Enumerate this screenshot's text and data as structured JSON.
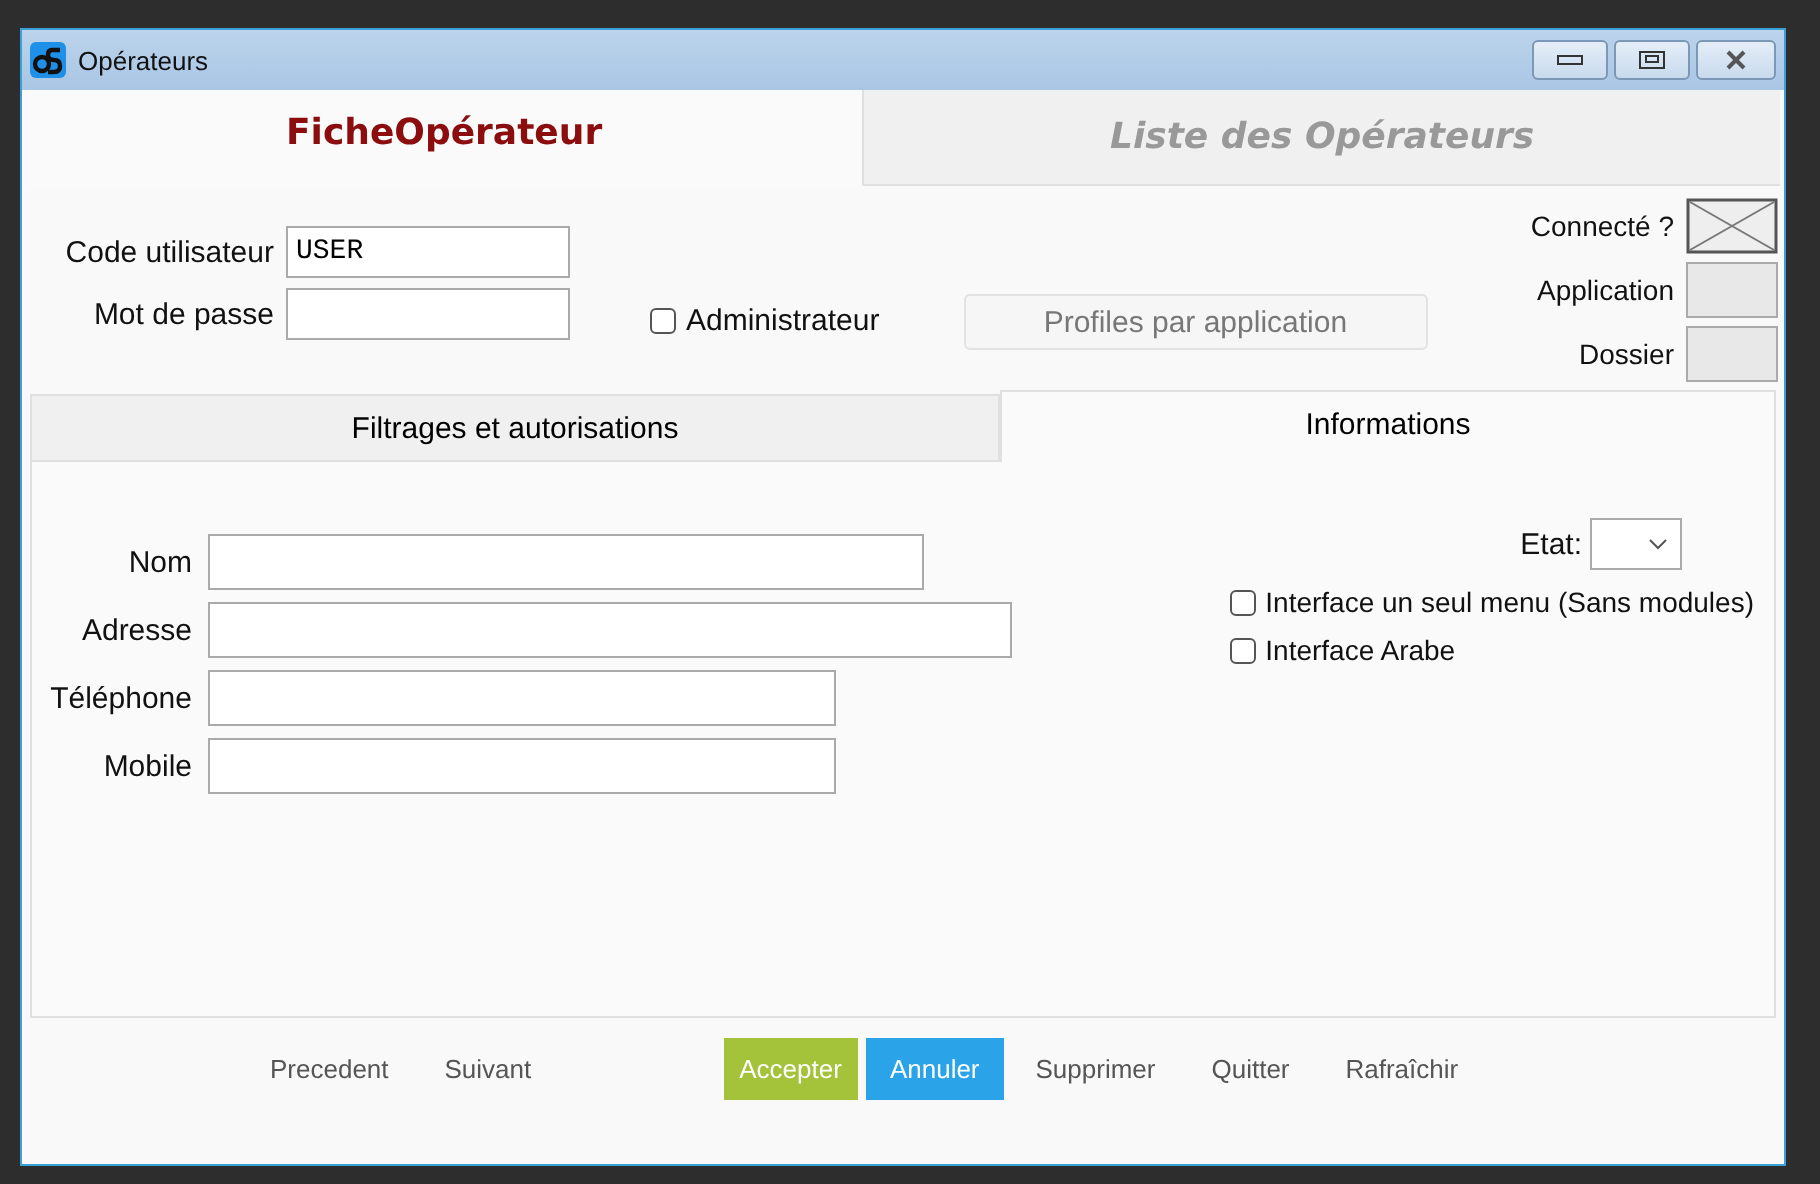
{
  "window": {
    "title": "Opérateurs"
  },
  "main_tabs": [
    {
      "label": "FicheOpérateur",
      "selected": true
    },
    {
      "label": "Liste des Opérateurs",
      "selected": false
    }
  ],
  "user_code": {
    "label": "Code utilisateur",
    "value": "USER"
  },
  "password": {
    "label": "Mot de passe"
  },
  "admin": {
    "label": "Administrateur",
    "checked": false
  },
  "profiles_button": {
    "label": "Profiles par application",
    "disabled": true
  },
  "status": [
    {
      "label": "Connecté ?",
      "kind": "crossed"
    },
    {
      "label": "Application",
      "kind": "empty"
    },
    {
      "label": "Dossier",
      "kind": "empty"
    }
  ],
  "sub_tabs": [
    {
      "label": "Filtrages et autorisations",
      "selected": false
    },
    {
      "label": "Informations",
      "selected": true
    }
  ],
  "fields": [
    {
      "label": "Nom"
    },
    {
      "label": "Adresse"
    },
    {
      "label": "Téléphone"
    },
    {
      "label": "Mobile"
    }
  ],
  "etat": {
    "label": "Etat:"
  },
  "options": [
    {
      "label": "Interface un seul menu (Sans modules)",
      "checked": false
    },
    {
      "label": "Interface Arabe",
      "checked": false
    }
  ],
  "buttons": [
    {
      "label": "Precedent",
      "kind": "link"
    },
    {
      "label": "Suivant",
      "kind": "link"
    },
    {
      "label": "Accepter",
      "kind": "accept"
    },
    {
      "label": "Annuler",
      "kind": "cancel"
    },
    {
      "label": "Supprimer",
      "kind": "link"
    },
    {
      "label": "Quitter",
      "kind": "link"
    },
    {
      "label": "Rafraîchir",
      "kind": "link"
    }
  ]
}
